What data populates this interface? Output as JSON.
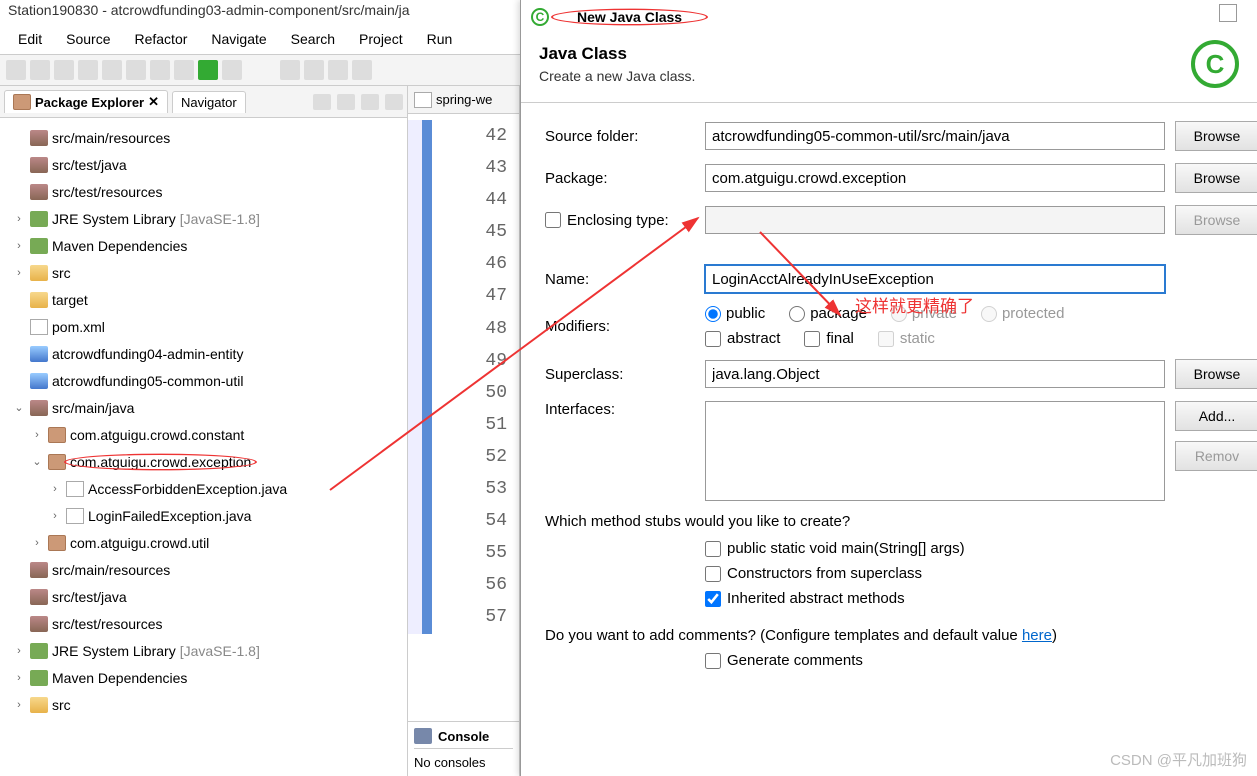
{
  "title": "Station190830 - atcrowdfunding03-admin-component/src/main/ja",
  "menu": [
    "Edit",
    "Source",
    "Refactor",
    "Navigate",
    "Search",
    "Project",
    "Run"
  ],
  "pkg_explorer_tab": "Package Explorer",
  "navigator_tab": "Navigator",
  "tree": [
    {
      "d": 0,
      "i": "jar",
      "t": "src/main/resources"
    },
    {
      "d": 0,
      "i": "jar",
      "t": "src/test/java"
    },
    {
      "d": 0,
      "i": "jar",
      "t": "src/test/resources"
    },
    {
      "d": 0,
      "a": ">",
      "i": "lib",
      "t": "JRE System Library ",
      "suf": "[JavaSE-1.8]"
    },
    {
      "d": 0,
      "a": ">",
      "i": "lib",
      "t": "Maven Dependencies"
    },
    {
      "d": 0,
      "a": ">",
      "i": "fld",
      "t": "src"
    },
    {
      "d": 0,
      "i": "fld",
      "t": "target"
    },
    {
      "d": 0,
      "i": "file",
      "t": "pom.xml"
    },
    {
      "d": 0,
      "i": "prj",
      "t": "atcrowdfunding04-admin-entity"
    },
    {
      "d": 0,
      "i": "prj",
      "t": "atcrowdfunding05-common-util"
    },
    {
      "d": 0,
      "a": "v",
      "i": "jar",
      "t": "src/main/java"
    },
    {
      "d": 1,
      "a": ">",
      "i": "pkg",
      "t": "com.atguigu.crowd.constant"
    },
    {
      "d": 1,
      "a": "v",
      "i": "pkg",
      "t": "com.atguigu.crowd.exception",
      "circ": true
    },
    {
      "d": 2,
      "a": ">",
      "i": "file",
      "t": "AccessForbiddenException.java"
    },
    {
      "d": 2,
      "a": ">",
      "i": "file",
      "t": "LoginFailedException.java"
    },
    {
      "d": 1,
      "a": ">",
      "i": "pkg",
      "t": "com.atguigu.crowd.util"
    },
    {
      "d": 0,
      "i": "jar",
      "t": "src/main/resources"
    },
    {
      "d": 0,
      "i": "jar",
      "t": "src/test/java"
    },
    {
      "d": 0,
      "i": "jar",
      "t": "src/test/resources"
    },
    {
      "d": 0,
      "a": ">",
      "i": "lib",
      "t": "JRE System Library ",
      "suf": "[JavaSE-1.8]"
    },
    {
      "d": 0,
      "a": ">",
      "i": "lib",
      "t": "Maven Dependencies"
    },
    {
      "d": 0,
      "a": ">",
      "i": "fld",
      "t": "src"
    }
  ],
  "editor_tab": "spring-we",
  "lines": [
    "42",
    "43",
    "44",
    "45",
    "46",
    "47",
    "48",
    "49",
    "50",
    "51",
    "52",
    "53",
    "54",
    "55",
    "56",
    "57"
  ],
  "console_tab": "Console",
  "console_msg": "No consoles ",
  "dialog": {
    "title": "New Java Class",
    "heading": "Java Class",
    "sub": "Create a new Java class.",
    "labels": {
      "src": "Source folder:",
      "pkg": "Package:",
      "enc": "Enclosing type:",
      "name": "Name:",
      "mod": "Modifiers:",
      "sup": "Superclass:",
      "ifc": "Interfaces:"
    },
    "values": {
      "src": "atcrowdfunding05-common-util/src/main/java",
      "pkg": "com.atguigu.crowd.exception",
      "enc": "",
      "name": "LoginAcctAlreadyInUseException",
      "sup": "java.lang.Object"
    },
    "modifiers": {
      "public": "public",
      "package": "package",
      "private": "private",
      "protected": "protected",
      "abstract": "abstract",
      "final": "final",
      "static": "static"
    },
    "browse": "Browse",
    "add": "Add...",
    "remove": "Remov",
    "stubs_q": "Which method stubs would you like to create?",
    "stubs": {
      "main": "public static void main(String[] args)",
      "cons": "Constructors from superclass",
      "inh": "Inherited abstract methods"
    },
    "comments_q": "Do you want to add comments? (Configure templates and default value ",
    "here": "here",
    "gen": "Generate comments"
  },
  "annot": "这样就更精确了",
  "watermark": "CSDN @平凡加班狗"
}
